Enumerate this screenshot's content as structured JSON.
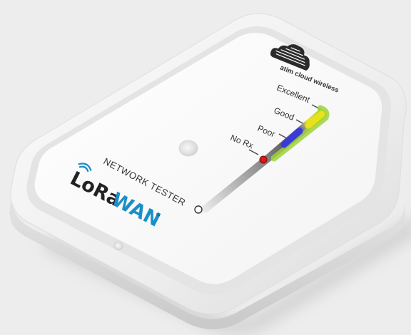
{
  "brand": {
    "name": "atim cloud wireless",
    "product": "NETWORK TESTER",
    "logo_left": "LoRa",
    "logo_right": "WAN",
    "trademark": "™",
    "logo_left_color": "#222222",
    "logo_right_color": "#1a8fc7",
    "icon": "cloud-logo-icon"
  },
  "signal_scale": {
    "levels": [
      {
        "label": "Excellent",
        "color": "#9fd23a"
      },
      {
        "label": "Good",
        "color": "#e8e11c"
      },
      {
        "label": "Poor",
        "color": "#3a3bd6"
      },
      {
        "label": "No Rx",
        "color": "#d81a1a"
      }
    ],
    "active_level": "No Rx"
  },
  "indicators": {
    "status_led": "off",
    "bottom_led": "off"
  },
  "colors": {
    "case": "#f4f4f4",
    "face": "#ffffff",
    "background": "#ededed"
  }
}
